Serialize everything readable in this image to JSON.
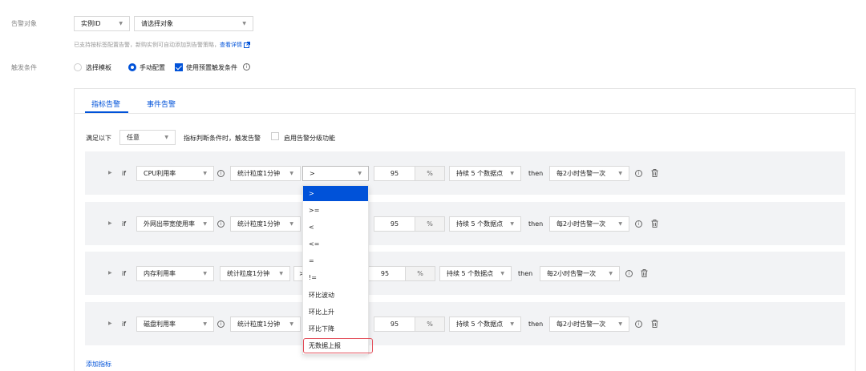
{
  "target": {
    "label": "告警对象",
    "type_select": "实例ID",
    "object_select_placeholder": "请选择对象",
    "hint": "已支持按标签配置告警，新购实例可自动添加到告警策略，",
    "hint_link": "查看详情"
  },
  "trigger": {
    "label": "触发条件",
    "option_template": "选择模板",
    "option_manual": "手动配置",
    "use_preset": "使用预置触发条件"
  },
  "tabs": [
    "指标告警",
    "事件告警"
  ],
  "rule_bar": {
    "prefix": "满足以下",
    "mode_select": "任意",
    "suffix": "指标判断条件时，触发告警",
    "grading": "启用告警分级功能"
  },
  "conditions": [
    {
      "if": "if",
      "metric": "CPU利用率",
      "granularity": "统计粒度1分钟",
      "operator": ">",
      "threshold": "95",
      "unit": "%",
      "duration": "持续 5 个数据点",
      "then": "then",
      "frequency": "每2小时告警一次"
    },
    {
      "if": "if",
      "metric": "外网出带宽使用率",
      "granularity": "统计粒度1分钟",
      "operator": ">",
      "threshold": "95",
      "unit": "%",
      "duration": "持续 5 个数据点",
      "then": "then",
      "frequency": "每2小时告警一次"
    },
    {
      "if": "if",
      "metric": "内存利用率",
      "granularity": "统计粒度1分钟",
      "operator": ">",
      "threshold": "95",
      "unit": "%",
      "duration": "持续 5 个数据点",
      "then": "then",
      "frequency": "每2小时告警一次"
    },
    {
      "if": "if",
      "metric": "磁盘利用率",
      "granularity": "统计粒度1分钟",
      "operator": ">",
      "threshold": "95",
      "unit": "%",
      "duration": "持续 5 个数据点",
      "then": "then",
      "frequency": "每2小时告警一次"
    }
  ],
  "operator_options": [
    ">",
    ">=",
    "<",
    "<=",
    "=",
    "!=",
    "环比波动",
    "环比上升",
    "环比下降",
    "无数据上报"
  ],
  "add_metric": "添加指标",
  "colors": {
    "accent": "#0052d9",
    "highlight": "#e34d59"
  }
}
